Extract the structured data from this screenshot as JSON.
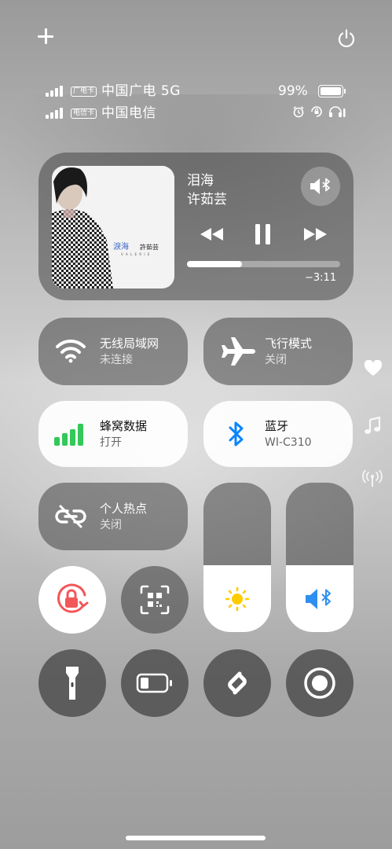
{
  "status": {
    "carrier1": {
      "tag": "广电卡",
      "name": "中国广电 5G"
    },
    "carrier2": {
      "tag": "电信卡",
      "name": "中国电信"
    },
    "battery_percent": "99%",
    "battery_level": 0.99,
    "icons": [
      "alarm-icon",
      "rotation-lock-icon",
      "headphones-icon"
    ]
  },
  "top_controls": {
    "add": "plus-icon",
    "power": "power-icon"
  },
  "media": {
    "title": "泪海",
    "artist": "许茹芸",
    "time_remaining": "−3:11",
    "progress": 0.36,
    "album_text": {
      "script": "淚海",
      "name": "許茹芸",
      "romanized": "V A L E R I E"
    },
    "controls": [
      "previous-icon",
      "pause-icon",
      "next-icon"
    ],
    "output_icon": "speaker-bluetooth-icon"
  },
  "tiles": {
    "wifi": {
      "title": "无线局域网",
      "subtitle": "未连接"
    },
    "airplane": {
      "title": "飞行模式",
      "subtitle": "关闭"
    },
    "cellular": {
      "title": "蜂窝数据",
      "subtitle": "打开"
    },
    "bluetooth": {
      "title": "蓝牙",
      "subtitle": "WI-C310"
    },
    "hotspot": {
      "title": "个人热点",
      "subtitle": "关闭"
    }
  },
  "sliders": {
    "brightness": 0.45,
    "volume": 0.45
  },
  "colors": {
    "cellular_green": "#34c759",
    "bluetooth_blue": "#0a84ff",
    "lock_red": "#f2575a",
    "sun_yellow": "#ffcc00",
    "volume_blue": "#2f8ff0"
  },
  "side_icons": [
    "heart-icon",
    "music-note-icon",
    "broadcast-icon"
  ]
}
